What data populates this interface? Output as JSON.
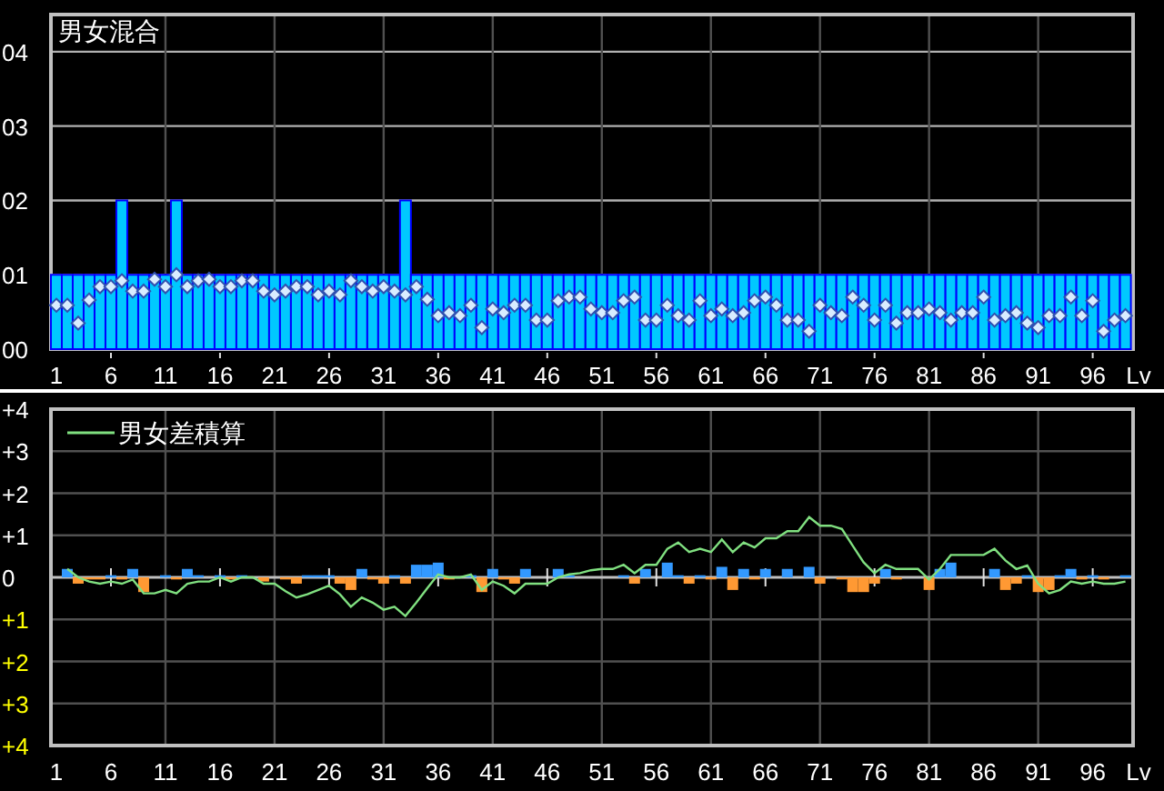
{
  "mixed_panel": {
    "chart_data": {
      "type": "bar",
      "title": "男女混合",
      "xlabel": "Lv",
      "grid": true,
      "xlim": [
        0.5,
        99.7
      ],
      "ylim": [
        0,
        4.5
      ],
      "x": [
        1,
        2,
        3,
        4,
        5,
        6,
        7,
        8,
        9,
        10,
        11,
        12,
        13,
        14,
        15,
        16,
        17,
        18,
        19,
        20,
        21,
        22,
        23,
        24,
        25,
        26,
        27,
        28,
        29,
        30,
        31,
        32,
        33,
        34,
        35,
        36,
        37,
        38,
        39,
        40,
        41,
        42,
        43,
        44,
        45,
        46,
        47,
        48,
        49,
        50,
        51,
        52,
        53,
        54,
        55,
        56,
        57,
        58,
        59,
        60,
        61,
        62,
        63,
        64,
        65,
        66,
        67,
        68,
        69,
        70,
        71,
        72,
        73,
        74,
        75,
        76,
        77,
        78,
        79,
        80,
        81,
        82,
        83,
        84,
        85,
        86,
        87,
        88,
        89,
        90,
        91,
        92,
        93,
        94,
        95,
        96,
        97,
        98,
        99
      ],
      "xticks": [
        1,
        6,
        11,
        16,
        21,
        26,
        31,
        36,
        41,
        46,
        51,
        56,
        61,
        66,
        71,
        76,
        81,
        86,
        91,
        96
      ],
      "yticks": [
        {
          "value": 0,
          "label": "00"
        },
        {
          "value": 1,
          "label": "01"
        },
        {
          "value": 2,
          "label": "02"
        },
        {
          "value": 3,
          "label": "03"
        },
        {
          "value": 4,
          "label": "04"
        }
      ],
      "series": [
        {
          "color": "#00c8ff",
          "values": [
            1,
            1,
            1,
            1,
            1,
            1,
            2,
            1,
            1,
            1,
            1,
            2,
            1,
            1,
            1,
            1,
            1,
            1,
            1,
            1,
            1,
            1,
            1,
            1,
            1,
            1,
            1,
            1,
            1,
            1,
            1,
            1,
            2,
            1,
            1,
            1,
            1,
            1,
            1,
            1,
            1,
            1,
            1,
            1,
            1,
            1,
            1,
            1,
            1,
            1,
            1,
            1,
            1,
            1,
            1,
            1,
            1,
            1,
            1,
            1,
            1,
            1,
            1,
            1,
            1,
            1,
            1,
            1,
            1,
            1,
            1,
            1,
            1,
            1,
            1,
            1,
            1,
            1,
            1,
            1,
            1,
            1,
            1,
            1,
            1,
            1,
            1,
            1,
            1,
            1,
            1,
            1,
            1,
            1,
            1,
            1,
            1,
            1,
            1
          ]
        },
        {
          "type": "scatter",
          "color": "#d8ecff",
          "values": [
            0.59,
            0.59,
            0.35,
            0.66,
            0.84,
            0.84,
            0.92,
            0.78,
            0.78,
            0.94,
            0.84,
            1.0,
            0.84,
            0.92,
            0.94,
            0.84,
            0.84,
            0.92,
            0.92,
            0.78,
            0.73,
            0.78,
            0.84,
            0.84,
            0.73,
            0.78,
            0.73,
            0.92,
            0.84,
            0.78,
            0.84,
            0.78,
            0.73,
            0.84,
            0.67,
            0.45,
            0.49,
            0.45,
            0.59,
            0.29,
            0.54,
            0.49,
            0.59,
            0.59,
            0.39,
            0.39,
            0.65,
            0.7,
            0.7,
            0.54,
            0.49,
            0.49,
            0.65,
            0.7,
            0.39,
            0.39,
            0.59,
            0.45,
            0.39,
            0.65,
            0.45,
            0.54,
            0.45,
            0.49,
            0.65,
            0.7,
            0.59,
            0.39,
            0.39,
            0.24,
            0.59,
            0.49,
            0.45,
            0.7,
            0.59,
            0.39,
            0.59,
            0.35,
            0.49,
            0.49,
            0.54,
            0.49,
            0.39,
            0.49,
            0.49,
            0.7,
            0.39,
            0.45,
            0.49,
            0.35,
            0.29,
            0.45,
            0.45,
            0.7,
            0.45,
            0.65,
            0.24,
            0.39,
            0.45
          ]
        }
      ]
    }
  },
  "difference_panel": {
    "chart_data": {
      "type": "bar",
      "xlabel": "Lv",
      "grid": true,
      "xlim": [
        0.5,
        99.7
      ],
      "ylim": [
        -4,
        4
      ],
      "x": [
        2,
        3,
        4,
        5,
        6,
        7,
        8,
        9,
        10,
        11,
        12,
        13,
        14,
        15,
        16,
        17,
        18,
        19,
        20,
        21,
        22,
        23,
        24,
        25,
        26,
        27,
        28,
        29,
        30,
        31,
        32,
        33,
        34,
        35,
        36,
        37,
        38,
        39,
        40,
        41,
        42,
        43,
        44,
        45,
        46,
        47,
        48,
        49,
        50,
        51,
        52,
        53,
        54,
        55,
        56,
        57,
        58,
        59,
        60,
        61,
        62,
        63,
        64,
        65,
        66,
        67,
        68,
        69,
        70,
        71,
        72,
        73,
        74,
        75,
        76,
        77,
        78,
        79,
        80,
        81,
        82,
        83,
        84,
        85,
        86,
        87,
        88,
        89,
        90,
        91,
        92,
        93,
        94,
        95,
        96,
        97,
        98,
        99
      ],
      "xticks": [
        1,
        6,
        11,
        16,
        21,
        26,
        31,
        36,
        41,
        46,
        51,
        56,
        61,
        66,
        71,
        76,
        81,
        86,
        91,
        96
      ],
      "yticks": [
        {
          "value": 4,
          "label": "+4"
        },
        {
          "value": 3,
          "label": "+3"
        },
        {
          "value": 2,
          "label": "+2"
        },
        {
          "value": 1,
          "label": "+1"
        },
        {
          "value": 0,
          "label": "0"
        },
        {
          "value": -1,
          "label": "+1"
        },
        {
          "value": -2,
          "label": "+2"
        },
        {
          "value": -3,
          "label": "+3"
        },
        {
          "value": -4,
          "label": "+4"
        }
      ],
      "series": [
        {
          "color": "#3399ff",
          "values": [
            0.2,
            null,
            null,
            null,
            0.05,
            null,
            0.2,
            null,
            null,
            0.05,
            null,
            0.2,
            0.05,
            null,
            0.05,
            null,
            0.05,
            null,
            null,
            null,
            null,
            null,
            0.05,
            0.05,
            0.05,
            null,
            null,
            0.2,
            null,
            null,
            0.05,
            null,
            0.3,
            0.3,
            0.35,
            null,
            null,
            0.05,
            null,
            0.2,
            null,
            null,
            0.2,
            null,
            null,
            0.2,
            0.05,
            null,
            null,
            null,
            null,
            0.05,
            null,
            0.2,
            null,
            0.35,
            0.05,
            null,
            0.05,
            null,
            0.25,
            null,
            0.2,
            null,
            0.2,
            null,
            0.2,
            null,
            0.25,
            null,
            null,
            null,
            null,
            null,
            null,
            0.2,
            null,
            null,
            null,
            null,
            0.2,
            0.35,
            null,
            null,
            null,
            0.2,
            null,
            null,
            0.05,
            null,
            null,
            0.05,
            0.2,
            null,
            0.05,
            null,
            null,
            0.05
          ]
        },
        {
          "color": "#ff9933",
          "values": [
            null,
            -0.15,
            -0.05,
            -0.05,
            null,
            -0.05,
            null,
            -0.35,
            null,
            null,
            -0.05,
            null,
            null,
            null,
            null,
            -0.05,
            null,
            null,
            -0.1,
            null,
            -0.05,
            -0.15,
            null,
            null,
            null,
            -0.15,
            -0.3,
            null,
            -0.05,
            -0.15,
            null,
            -0.15,
            null,
            null,
            null,
            -0.05,
            null,
            null,
            -0.35,
            null,
            -0.05,
            -0.15,
            null,
            null,
            null,
            null,
            null,
            null,
            null,
            null,
            null,
            null,
            -0.15,
            null,
            null,
            null,
            null,
            -0.15,
            null,
            -0.05,
            null,
            -0.3,
            null,
            -0.05,
            null,
            null,
            null,
            null,
            null,
            -0.15,
            null,
            -0.05,
            -0.35,
            -0.35,
            -0.15,
            null,
            -0.05,
            null,
            null,
            -0.3,
            null,
            null,
            null,
            null,
            null,
            null,
            -0.3,
            -0.15,
            null,
            -0.35,
            -0.3,
            null,
            null,
            -0.05,
            null,
            -0.05,
            null,
            null
          ]
        },
        {
          "type": "line",
          "name": "男女差積算",
          "color": "#80e080",
          "values": [
            0.2,
            0,
            -0.1,
            -0.15,
            -0.1,
            -0.15,
            -0.05,
            -0.38,
            -0.38,
            -0.3,
            -0.38,
            -0.15,
            -0.1,
            -0.1,
            0,
            -0.1,
            0,
            0,
            -0.15,
            -0.15,
            -0.33,
            -0.48,
            -0.4,
            -0.3,
            -0.2,
            -0.4,
            -0.7,
            -0.48,
            -0.6,
            -0.77,
            -0.7,
            -0.92,
            -0.6,
            -0.26,
            0.07,
            0,
            0,
            0.07,
            -0.3,
            -0.1,
            -0.2,
            -0.38,
            -0.15,
            -0.15,
            -0.15,
            0,
            0.07,
            0.1,
            0.17,
            0.2,
            0.2,
            0.3,
            0.1,
            0.3,
            0.3,
            0.68,
            0.83,
            0.6,
            0.68,
            0.6,
            0.9,
            0.6,
            0.83,
            0.71,
            0.93,
            0.93,
            1.1,
            1.1,
            1.43,
            1.23,
            1.23,
            1.15,
            0.75,
            0.36,
            0.1,
            0.3,
            0.2,
            0.2,
            0.2,
            -0.05,
            0.2,
            0.53,
            0.53,
            0.53,
            0.53,
            0.68,
            0.4,
            0.2,
            0.28,
            -0.15,
            -0.38,
            -0.3,
            -0.1,
            -0.15,
            -0.1,
            -0.15,
            -0.15,
            -0.1
          ]
        }
      ]
    }
  }
}
